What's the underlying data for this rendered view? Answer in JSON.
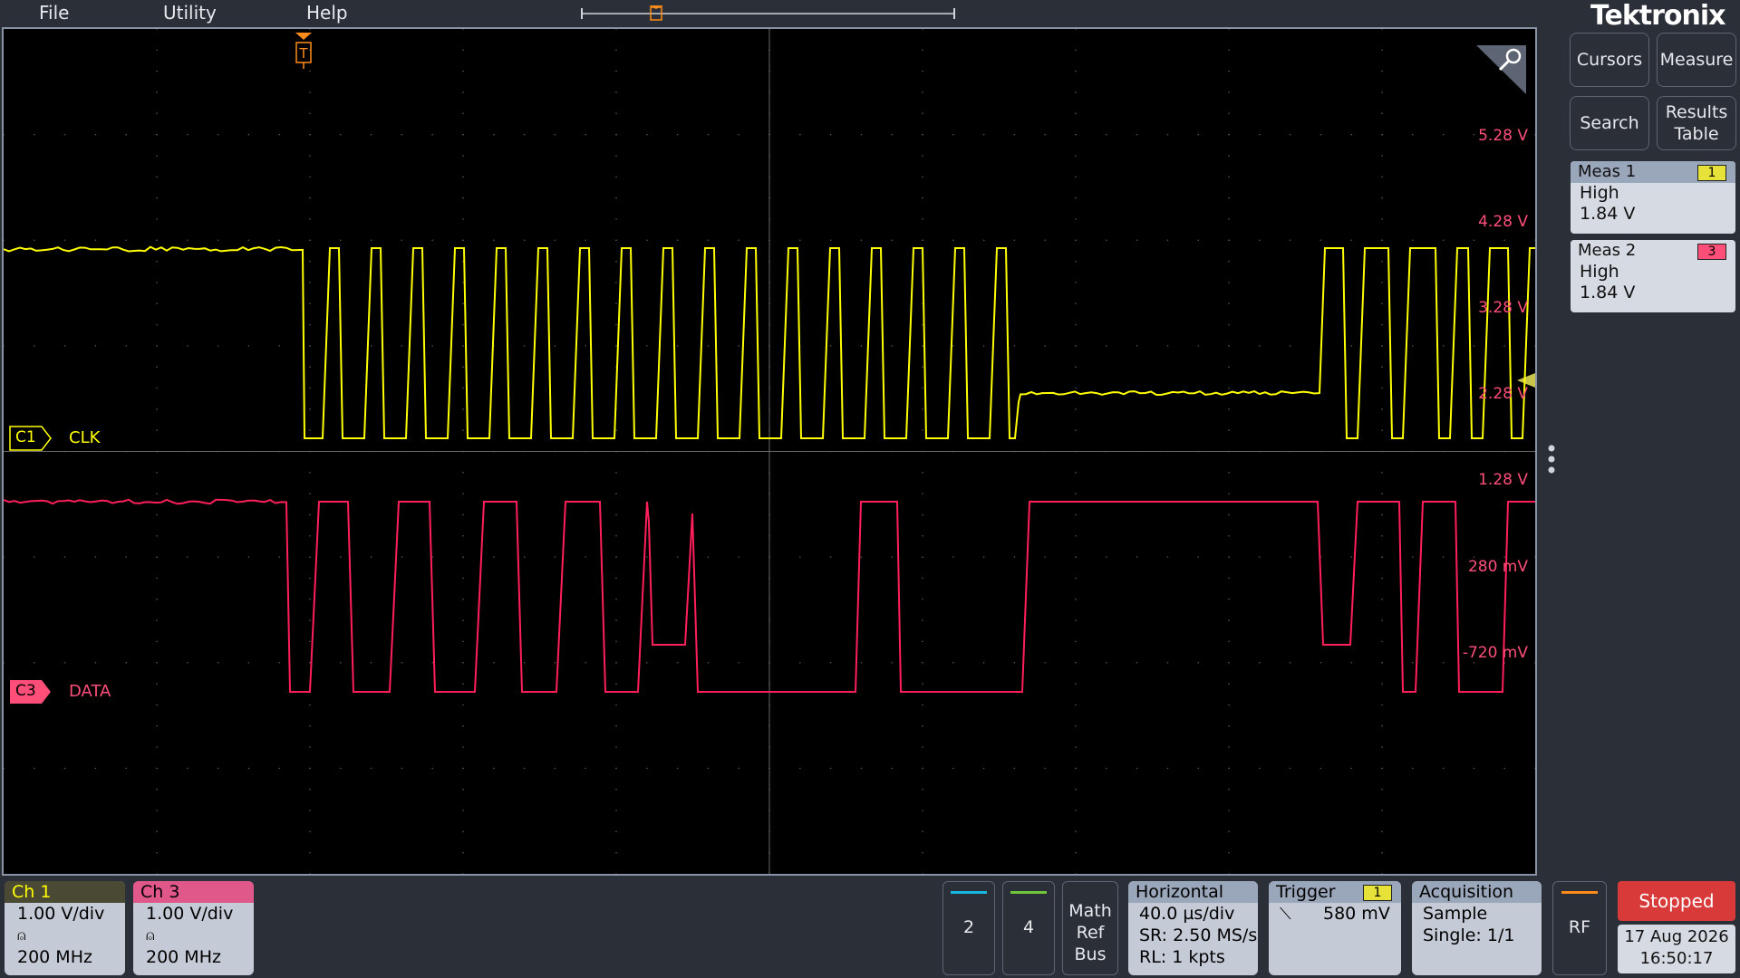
{
  "menu": {
    "file": "File",
    "utility": "Utility",
    "help": "Help"
  },
  "brand": "Tektronix",
  "trigger_marker": "T",
  "scale_labels": [
    "5.28 V",
    "4.28 V",
    "3.28 V",
    "2.28 V",
    "1.28 V",
    "280 mV",
    "-720 mV"
  ],
  "channels": {
    "c1": {
      "tag": "C1",
      "name": "CLK",
      "color": "#ffff00"
    },
    "c3": {
      "tag": "C3",
      "name": "DATA",
      "color": "#ff1f5a"
    }
  },
  "tools": {
    "cursors": "Cursors",
    "measure": "Measure",
    "search": "Search",
    "results_table": "Results Table"
  },
  "measurements": [
    {
      "title": "Meas 1",
      "source": "1",
      "type": "High",
      "value": "1.84 V"
    },
    {
      "title": "Meas 2",
      "source": "3",
      "type": "High",
      "value": "1.84 V"
    }
  ],
  "bottom": {
    "ch1": {
      "title": "Ch 1",
      "scale": "1.00 V/div",
      "bw": "200 MHz"
    },
    "ch3": {
      "title": "Ch 3",
      "scale": "1.00 V/div",
      "bw": "200 MHz"
    },
    "ch2_btn": "2",
    "ch4_btn": "4",
    "math_ref_bus": [
      "Math",
      "Ref",
      "Bus"
    ],
    "horizontal": {
      "title": "Horizontal",
      "scale": "40.0 µs/div",
      "sr": "SR: 2.50 MS/s",
      "rl": "RL: 1 kpts"
    },
    "trigger": {
      "title": "Trigger",
      "source": "1",
      "level": "580 mV"
    },
    "acquisition": {
      "title": "Acquisition",
      "mode": "Sample",
      "single": "Single: 1/1"
    },
    "rf": "RF",
    "status": "Stopped",
    "date": "17 Aug 2026",
    "time": "16:50:17"
  },
  "colors": {
    "ch1": "#ffff00",
    "ch3": "#ff1f5a",
    "ch2": "#16b8e0",
    "ch4": "#6fc63a",
    "trigger": "#ff8c1a"
  }
}
